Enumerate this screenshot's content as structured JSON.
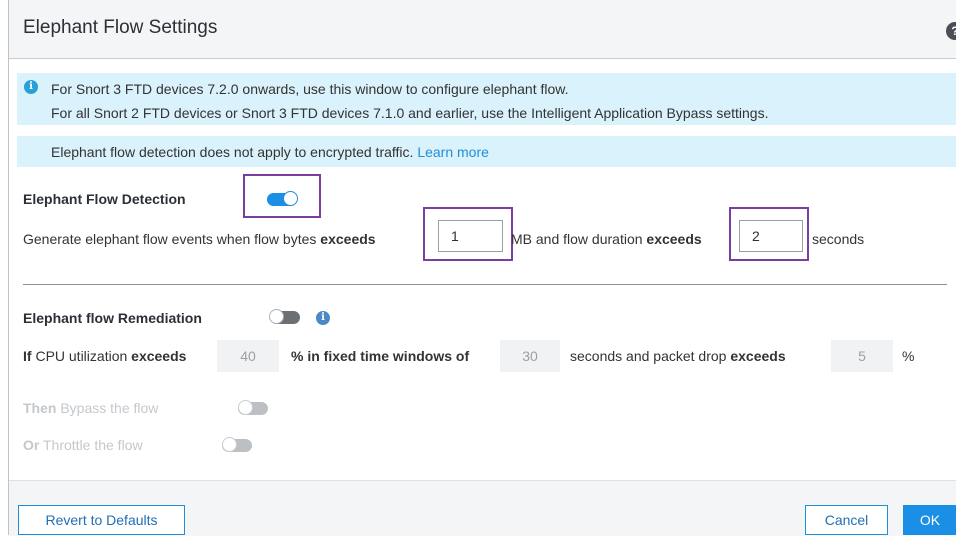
{
  "dialog": {
    "title": "Elephant Flow Settings",
    "help_glyph": "?"
  },
  "info": {
    "glyph": "i",
    "line1": "For Snort 3 FTD devices 7.2.0 onwards, use this window to configure elephant flow.",
    "line2": "For all Snort 2 FTD devices or Snort 3 FTD devices 7.1.0 and earlier, use the Intelligent Application Bypass settings.",
    "note": "Elephant flow detection does not apply to encrypted traffic.",
    "learn_more": "Learn more"
  },
  "detection": {
    "label": "Elephant Flow Detection",
    "enabled": true,
    "text1": "Generate elephant flow events when flow bytes ",
    "exceeds1": "exceeds",
    "bytes_value": "1",
    "text2": "MB and flow duration ",
    "exceeds2": "exceeds",
    "duration_value": "2",
    "text3": "seconds"
  },
  "remediation": {
    "label": "Elephant flow Remediation",
    "enabled": false,
    "info_glyph": "i",
    "if": "If",
    "cpu_text": " CPU utilization ",
    "exceeds": "exceeds",
    "cpu_value": "40",
    "pct_text": "% in fixed time windows of",
    "window_value": "30",
    "seconds_text": "seconds and packet drop ",
    "exceeds2": "exceeds",
    "drop_value": "5",
    "pct2": "%",
    "then": "Then",
    "bypass_text": " Bypass the flow",
    "or": "Or",
    "throttle_text": " Throttle the flow"
  },
  "footer": {
    "revert_label": "Revert to Defaults",
    "cancel_label": "Cancel",
    "ok_label": "OK"
  },
  "colors": {
    "accent": "#1b8ee5",
    "highlight": "#7a3da0",
    "info_bg": "#d9f2fb"
  }
}
